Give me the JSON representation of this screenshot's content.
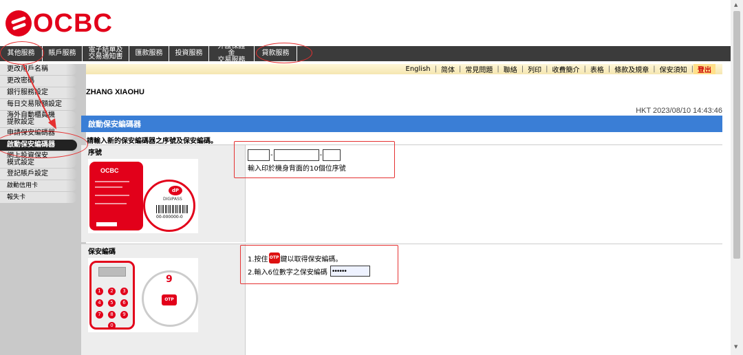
{
  "brand": {
    "name": "OCBC",
    "color": "#e2001a"
  },
  "topnav": [
    {
      "label": "其他服務",
      "active": true
    },
    {
      "label": "賬戶服務",
      "active": false
    },
    {
      "label": "電子結單及\n交易通知書",
      "active": false
    },
    {
      "label": "匯款服務",
      "active": false
    },
    {
      "label": "投資服務",
      "active": false
    },
    {
      "label": "外匯保證金\n交易服務",
      "active": false
    },
    {
      "label": "貸款服務",
      "active": false
    }
  ],
  "utilbar": [
    "English",
    "简体",
    "常見問題",
    "聯絡",
    "列印",
    "收費簡介",
    "表格",
    "條款及規章",
    "保安須知"
  ],
  "logout": "登出",
  "sidebar": [
    {
      "label": "更改用戶名稱"
    },
    {
      "label": "更改密碼"
    },
    {
      "label": "銀行服務設定"
    },
    {
      "label": "每日交易限額設定"
    },
    {
      "label": "海外自動櫃員機\n提款設定",
      "tall": true
    },
    {
      "label": "申請保安編碼器"
    },
    {
      "label": "啟動保安編碼器",
      "active": true
    },
    {
      "label": "網上投資保安\n模式設定",
      "tall": true
    },
    {
      "label": "登記賬戶設定"
    },
    {
      "label": "啟動信用卡",
      "small": true
    },
    {
      "label": "報失卡",
      "small": true
    }
  ],
  "username": "ZHANG XIAOHU",
  "timestamp": "HKT 2023/08/10 14:43:46",
  "section_title": "啟動保安編碼器",
  "instruction": "請輸入新的保安編碼器之序號及保安編碼。",
  "serial": {
    "label": "序號",
    "dash": "-",
    "hint": "輸入印於機身背面的10個位序號",
    "field1": "",
    "field2": "",
    "field3": ""
  },
  "token_card": {
    "card_brand": "OCBC",
    "circle_brand": "dP",
    "circle_product": "DIGIPASS",
    "serial_sample": "00-000000-0"
  },
  "security_code": {
    "label": "保安編碼",
    "step1_prefix": "1.按住",
    "otp_badge": "OTP",
    "step1_suffix": "鍵以取得保安編碼。",
    "step2": "2.輸入6位數字之保安編碼",
    "value": "••••••"
  },
  "keypad": {
    "keys": [
      "1",
      "2",
      "3",
      "4",
      "5",
      "6",
      "7",
      "8",
      "9",
      "0"
    ],
    "zoom_digit": "9",
    "zoom_otp": "OTP"
  }
}
